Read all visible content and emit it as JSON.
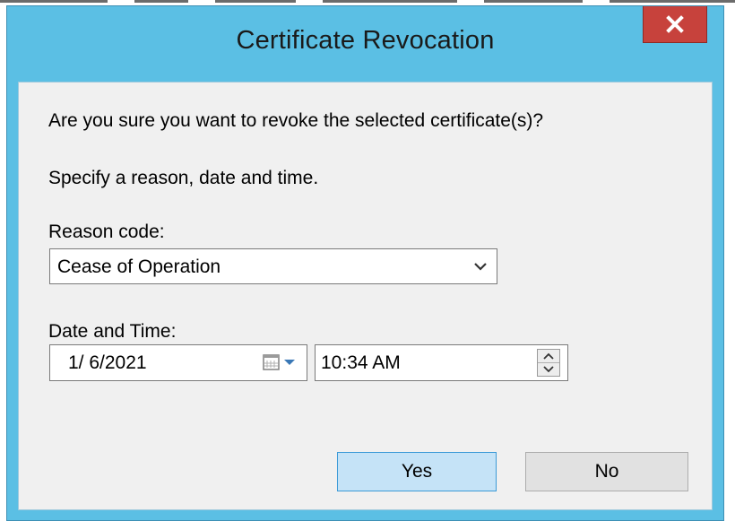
{
  "window": {
    "title": "Certificate Revocation",
    "close_label": "x"
  },
  "dialog": {
    "question": "Are you sure you want to revoke the selected certificate(s)?",
    "instruction": "Specify a reason, date and time.",
    "reason_label": "Reason code:",
    "reason_value": "Cease of Operation",
    "datetime_label": "Date and Time:",
    "date_value": "1/ 6/2021",
    "time_value": "10:34 AM"
  },
  "buttons": {
    "yes": "Yes",
    "no": "No"
  },
  "icons": {
    "close": "close-icon",
    "combo_arrow": "chevron-down-icon",
    "calendar": "calendar-icon",
    "spin_up": "spin-up-icon",
    "spin_down": "spin-down-icon"
  },
  "colors": {
    "title_bar": "#5bbfe4",
    "close_button": "#c7423c",
    "client_bg": "#f0f0f0",
    "default_button": "#c5e3f7",
    "default_button_border": "#3c9ad7"
  }
}
